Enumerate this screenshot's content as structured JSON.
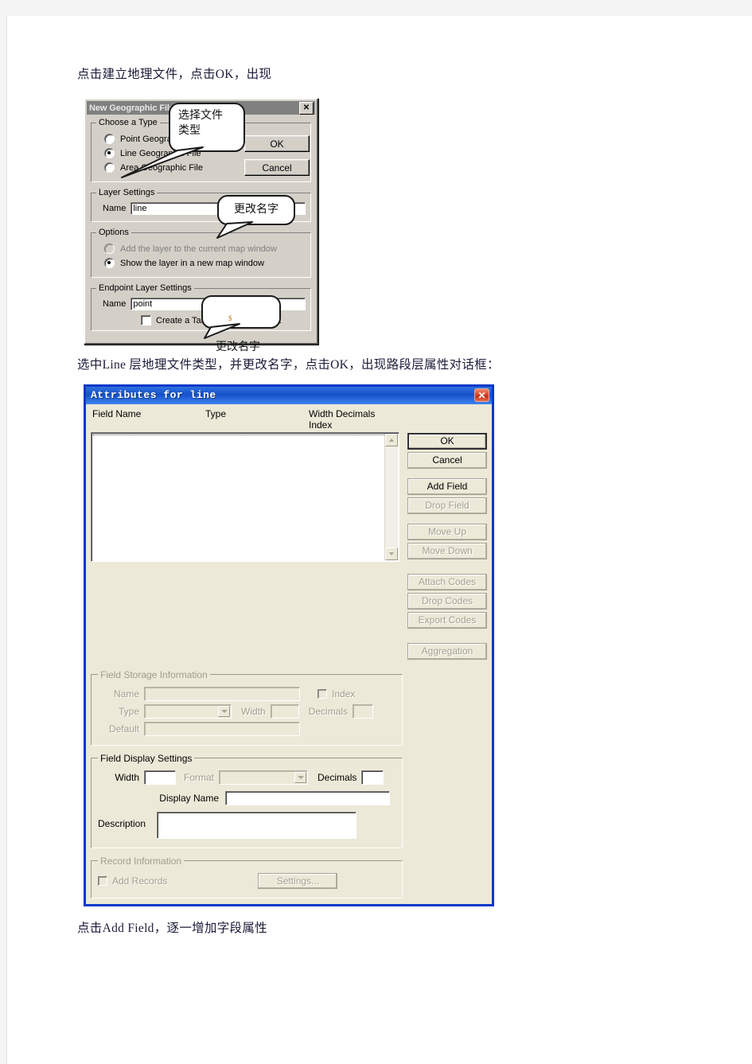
{
  "document": {
    "paragraph_1": "点击建立地理文件，点击OK，出现",
    "paragraph_2": "选中Line  层地理文件类型，并更改名字，点击OK，出现路段层属性对话框：",
    "paragraph_3": "点击Add  Field，逐一增加字段属性"
  },
  "dialog_new_geographic_file": {
    "title": "New Geographic File",
    "close_label": "✕",
    "choose_type": {
      "legend": "Choose a Type",
      "options": [
        {
          "label": "Point Geographic File",
          "checked": false,
          "accel": "P"
        },
        {
          "label": "Line Geographic File",
          "checked": true,
          "accel": "L"
        },
        {
          "label": "Area Geographic File",
          "checked": false,
          "accel": "A"
        }
      ]
    },
    "layer_settings": {
      "legend": "Layer Settings",
      "name_label": "Name",
      "name_value": "line"
    },
    "options": {
      "legend": "Options",
      "items": [
        {
          "label": "Add the layer to the current map window",
          "checked": false,
          "disabled": true
        },
        {
          "label": "Show the layer in a new map window",
          "checked": true,
          "disabled": false
        }
      ]
    },
    "endpoint_layer_settings": {
      "legend": "Endpoint Layer Settings",
      "name_label": "Name",
      "name_value": "point",
      "checkbox_label": "Create a Table for endpoint data",
      "checkbox_checked": false
    },
    "buttons": {
      "ok": "OK",
      "cancel": "Cancel"
    }
  },
  "callouts": [
    {
      "id": "type",
      "text": "选择文件\n类型"
    },
    {
      "id": "name1",
      "text": "更改名字"
    },
    {
      "id": "name2",
      "marker": "$",
      "text": "更改名字"
    }
  ],
  "dialog_attributes": {
    "title": "Attributes for line",
    "close_label": "✕",
    "column_headers": {
      "field_name": "Field Name",
      "type": "Type",
      "width_decimals_index": "Width Decimals Index"
    },
    "list_rows": [],
    "buttons": [
      {
        "label": "OK",
        "disabled": false,
        "default": true
      },
      {
        "label": "Cancel",
        "disabled": false,
        "default": false
      },
      {
        "label": "Add Field",
        "disabled": false,
        "default": false
      },
      {
        "label": "Drop Field",
        "disabled": true,
        "default": false
      },
      {
        "label": "Move Up",
        "disabled": true,
        "default": false
      },
      {
        "label": "Move Down",
        "disabled": true,
        "default": false
      },
      {
        "label": "Attach Codes",
        "disabled": true,
        "default": false
      },
      {
        "label": "Drop Codes",
        "disabled": true,
        "default": false
      },
      {
        "label": "Export Codes",
        "disabled": true,
        "default": false
      },
      {
        "label": "Aggregation",
        "disabled": true,
        "default": false
      }
    ],
    "field_storage_information": {
      "legend": "Field Storage Information",
      "name_label": "Name",
      "name_value": "",
      "index_label": "Index",
      "index_checked": false,
      "type_label": "Type",
      "type_value": "",
      "width_label": "Width",
      "width_value": "",
      "decimals_label": "Decimals",
      "decimals_value": "",
      "default_label": "Default",
      "default_value": "",
      "disabled": true
    },
    "field_display_settings": {
      "legend": "Field Display Settings",
      "width_label": "Width",
      "width_value": "",
      "format_label": "Format",
      "format_value": "",
      "decimals_label": "Decimals",
      "decimals_value": "",
      "display_name_label": "Display Name",
      "display_name_value": "",
      "description_label": "Description",
      "description_value": ""
    },
    "record_information": {
      "legend": "Record Information",
      "add_records_label": "Add Records",
      "add_records_checked": false,
      "settings_label": "Settings...",
      "disabled": true
    }
  },
  "colors": {
    "dialog1_face": "#d4d0c8",
    "dialog1_titlebar": "#808080",
    "dialog2_face": "#ece9d8",
    "dialog2_frame": "#0a38c8",
    "dialog2_titlebar": "#1552c8",
    "close_red": "#c3331a",
    "text": "#1c1c3a"
  }
}
